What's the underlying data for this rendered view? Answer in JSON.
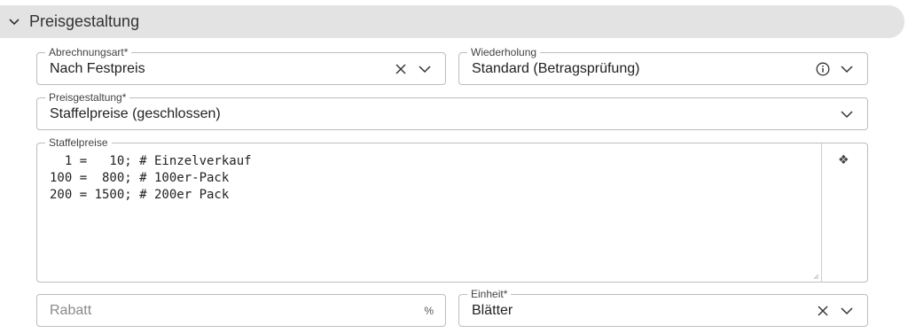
{
  "section": {
    "title": "Preisgestaltung"
  },
  "fields": {
    "abrechnungsart": {
      "label": "Abrechnungsart*",
      "value": "Nach Festpreis"
    },
    "wiederholung": {
      "label": "Wiederholung",
      "value": "Standard (Betragsprüfung)"
    },
    "preisgestaltung": {
      "label": "Preisgestaltung*",
      "value": "Staffelpreise (geschlossen)"
    },
    "staffelpreise": {
      "label": "Staffelpreise",
      "value": "  1 =   10; # Einzelverkauf\n100 =  800; # 100er-Pack\n200 = 1500; # 200er Pack",
      "side_glyph": "❖"
    },
    "rabatt": {
      "placeholder": "Rabatt",
      "suffix": "%"
    },
    "einheit": {
      "label": "Einheit*",
      "value": "Blätter"
    }
  },
  "icons": {
    "section_toggle": "chevron-down-icon",
    "clear": "close-icon",
    "dropdown": "chevron-down-icon",
    "info": "info-icon",
    "drag": "move-icon",
    "resize": "resize-grip-icon"
  }
}
